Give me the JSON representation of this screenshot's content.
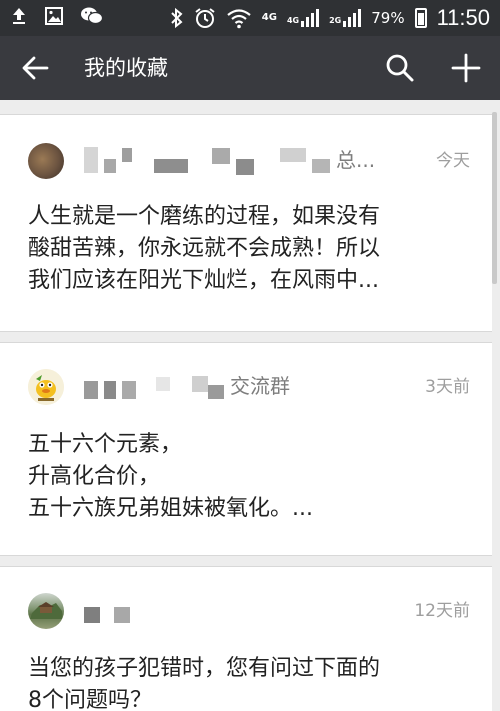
{
  "status_bar": {
    "icons_left": [
      "upload-icon",
      "image-icon",
      "wechat-icon"
    ],
    "icons_right": [
      "bluetooth-icon",
      "alarm-icon",
      "wifi-icon",
      "signal-icon"
    ],
    "network_1": "4G",
    "network_2": "4G",
    "network_3": "2G",
    "battery": "79%",
    "time": "11:50"
  },
  "header": {
    "title": "我的收藏",
    "back_icon": "back-arrow-icon",
    "search_icon": "search-icon",
    "add_icon": "plus-icon"
  },
  "favorites": [
    {
      "source": "总...",
      "time": "今天",
      "lines": [
        "人生就是一个磨练的过程，如果没有",
        "酸甜苦辣，你永远就不会成熟！所以",
        "我们应该在阳光下灿烂，在风雨中..."
      ]
    },
    {
      "source": "交流群",
      "time": "3天前",
      "lines": [
        "五十六个元素，",
        "升高化合价，",
        "五十六族兄弟姐妹被氧化。..."
      ]
    },
    {
      "source": "",
      "time": "12天前",
      "lines": [
        "当您的孩子犯错时，您有问过下面的",
        "8个问题吗？"
      ]
    }
  ],
  "colors": {
    "status_bar_bg": "#2f3134",
    "app_bar_bg": "#393a3f",
    "page_bg": "#ededed",
    "card_bg": "#ffffff"
  }
}
